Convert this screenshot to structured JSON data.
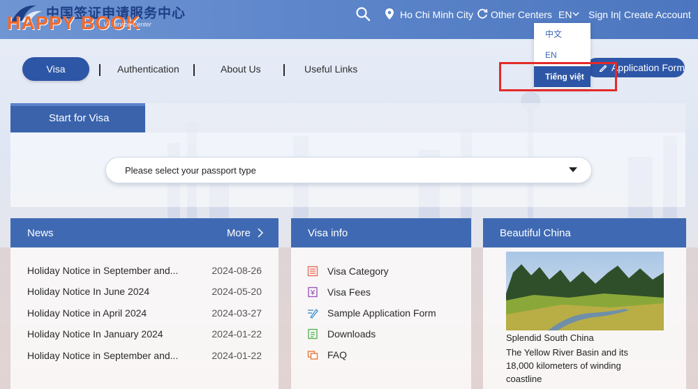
{
  "header": {
    "logo": {
      "chinese_text": "中国签证申请服务中心",
      "brand_text": "HAPPY BOOK",
      "subtitle_fragment": "V... ervice Center"
    },
    "location": "Ho Chi Minh City",
    "other_centers": "Other Centers",
    "language": "EN",
    "sign_in": "Sign In",
    "separator": "|",
    "create_account": "Create Account"
  },
  "language_dropdown": {
    "options": [
      {
        "label": "中文"
      },
      {
        "label": "EN"
      },
      {
        "label": "Tiếng việt"
      }
    ],
    "highlighted": "Tiếng việt"
  },
  "main_nav": {
    "items": [
      {
        "label": "Visa",
        "active": true
      },
      {
        "label": "Authentication"
      },
      {
        "label": "About Us"
      },
      {
        "label": "Useful Links"
      }
    ],
    "application_form": "Application Form"
  },
  "start_panel": {
    "tab_label": "Start for Visa",
    "passport_placeholder": "Please select your passport type"
  },
  "news": {
    "title": "News",
    "more": "More",
    "items": [
      {
        "title": "Holiday Notice in September and...",
        "date": "2024-08-26"
      },
      {
        "title": "Holiday Notice In June 2024",
        "date": "2024-05-20"
      },
      {
        "title": "Holiday Notice in April 2024",
        "date": "2024-03-27"
      },
      {
        "title": "Holiday Notice In January 2024",
        "date": "2024-01-22"
      },
      {
        "title": "Holiday Notice in September and...",
        "date": "2024-01-22"
      }
    ]
  },
  "visa_info": {
    "title": "Visa info",
    "items": [
      {
        "label": "Visa Category",
        "icon": "category-list-icon"
      },
      {
        "label": "Visa Fees",
        "icon": "fees-icon"
      },
      {
        "label": "Sample Application Form",
        "icon": "form-pen-icon"
      },
      {
        "label": "Downloads",
        "icon": "download-doc-icon"
      },
      {
        "label": "FAQ",
        "icon": "faq-icon"
      }
    ]
  },
  "beautiful_china": {
    "title": "Beautiful China",
    "caption": "Splendid South China",
    "description": "The Yellow River Basin and its 18,000 kilometers of winding coastline"
  },
  "colors": {
    "primary_blue": "#2d56a6",
    "header_blue": "#5b84c9",
    "card_header_blue": "#3f6ab3",
    "logo_orange": "#f2692b",
    "highlight_red": "#e52929"
  }
}
